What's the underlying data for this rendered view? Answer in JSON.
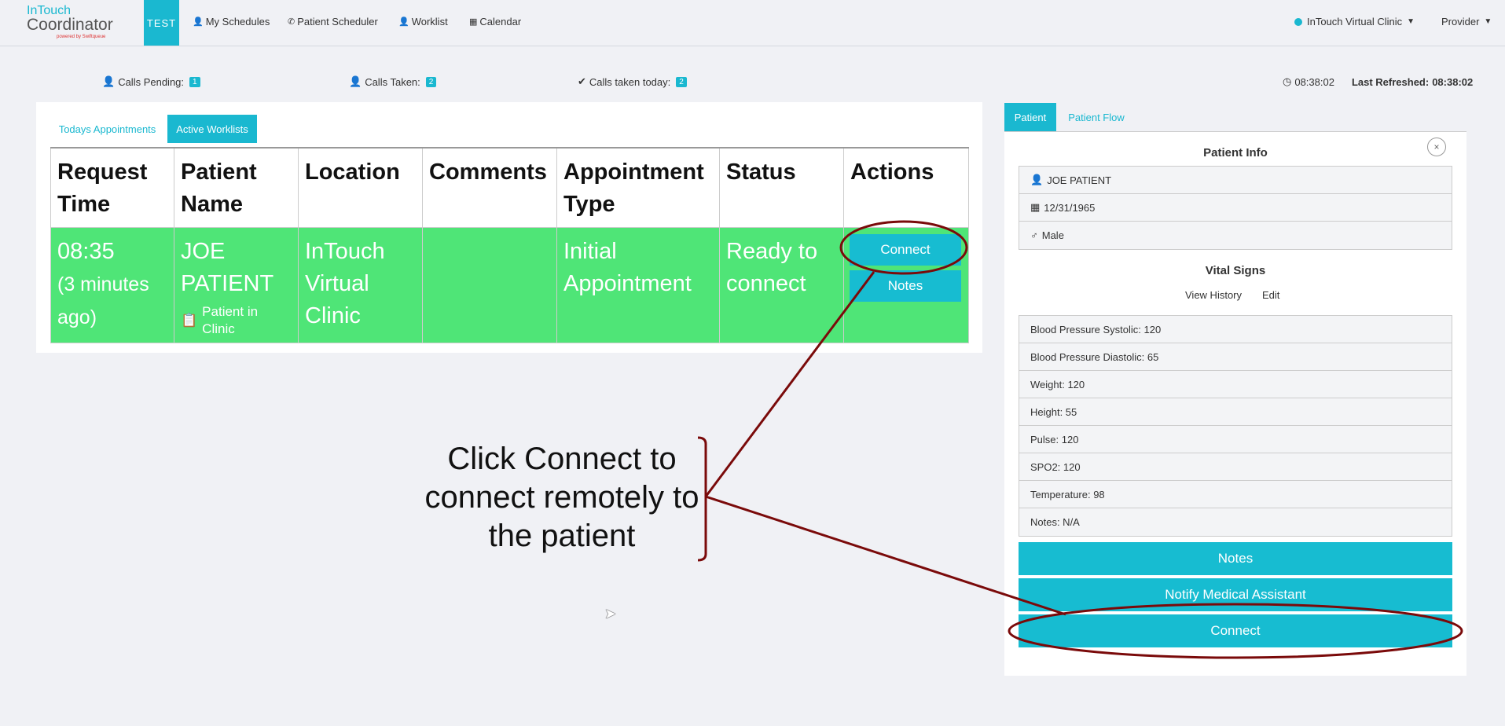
{
  "nav": {
    "logo_top": "InTouch",
    "logo_main": "Coordinator",
    "logo_sub": "powered by Swiftqueue",
    "env": "TEST",
    "links": [
      "My Schedules",
      "Patient Scheduler",
      "Worklist",
      "Calendar"
    ],
    "clinic": "InTouch Virtual Clinic",
    "role": "Provider"
  },
  "stats": {
    "pending_label": "Calls Pending:",
    "pending_count": "1",
    "taken_label": "Calls Taken:",
    "taken_count": "2",
    "today_label": "Calls taken today:",
    "today_count": "2",
    "clock": "08:38:02",
    "refreshed_label": "Last Refreshed:",
    "refreshed_time": "08:38:02"
  },
  "tabs": {
    "todays": "Todays Appointments",
    "active": "Active Worklists"
  },
  "table": {
    "headers": [
      "Request Time",
      "Patient Name",
      "Location",
      "Comments",
      "Appointment Type",
      "Status",
      "Actions"
    ],
    "row": {
      "time": "08:35",
      "ago": "(3 minutes ago)",
      "patient": "JOE PATIENT",
      "patient_note": "Patient in Clinic",
      "location": "InTouch Virtual Clinic",
      "comments": "",
      "type": "Initial Appointment",
      "status": "Ready to connect",
      "connect": "Connect",
      "notes": "Notes"
    }
  },
  "right": {
    "tab_patient": "Patient",
    "tab_flow": "Patient Flow",
    "close": "×",
    "info_title": "Patient Info",
    "name": "JOE PATIENT",
    "dob": "12/31/1965",
    "sex": "Male",
    "vitals_title": "Vital Signs",
    "view_history": "View History",
    "edit": "Edit",
    "vitals": [
      "Blood Pressure Systolic: 120",
      "Blood Pressure Diastolic: 65",
      "Weight: 120",
      "Height: 55",
      "Pulse: 120",
      "SPO2: 120",
      "Temperature: 98",
      "Notes: N/A"
    ],
    "btn_notes": "Notes",
    "btn_notify": "Notify Medical Assistant",
    "btn_connect": "Connect"
  },
  "annotation": {
    "text": "Click Connect to connect remotely to the patient"
  },
  "colors": {
    "accent": "#1ab8d0",
    "row_green": "#4fe577",
    "annotation": "#7a0a0a"
  }
}
